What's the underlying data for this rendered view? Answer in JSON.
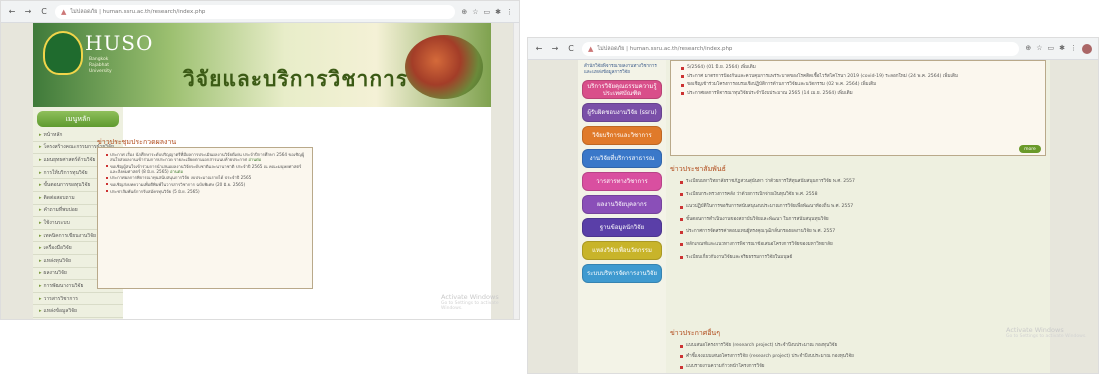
{
  "left": {
    "url": "ไม่ปลอดภัย | human.ssru.ac.th/research/index.php",
    "banner": {
      "logo_text": "HUSO",
      "logo_sub": "Bangkok Rajabhat University",
      "title": "วิจัยและบริการวิชาการ"
    },
    "nav_heading": "เมนูหลัก",
    "nav_items": [
      "หน้าหลัก",
      "โครงสร้างคณะกรรมการฝ่ายวิจัย",
      "แผนยุทธศาสตร์ด้านวิจัย",
      "การให้บริการทุนวิจัย",
      "ขั้นตอนการขอทุนวิจัย",
      "ติดต่อสอบถาม",
      "คำถามที่พบบ่อย",
      "ใช้งานระบบ",
      "เทคนิคการเขียนงานวิจัย",
      "เครื่องมือวิจัย",
      "แหล่งทุนวิจัย",
      "ผลงานวิจัย",
      "การพัฒนางานวิจัย",
      "วารสารวิชาการ",
      "แหล่งข้อมูลวิจัย",
      "การติดต่อหน่วยงาน"
    ],
    "section_title": "ข่าวประชุมประกวดผลงาน",
    "news": [
      "ประกาศ เรื่อง นักศึกษาระดับปริญญาตรีที่มีผลการประเมินผลงานวิจัยดีเด่น ประจำปีการศึกษา 2564 ขอเชิญผู้สนใจส่งผลงานเข้าร่วมการประกวด รายละเอียดตามเอกสารแนบท้ายประกาศ",
      "ขอเชิญผู้สนใจเข้าร่วมการนำเสนอผลงานวิจัยระดับชาติและนานาชาติ ประจำปี 2565 ณ คณะมนุษยศาสตร์และสังคมศาสตร์ (8 มิ.ย. 2565)",
      "ประกาศผลการพิจารณาทุนสนับสนุนการวิจัย งบประมาณรายได้ ประจำปี 2565",
      "ขอเชิญส่งบทความเพื่อตีพิมพ์ในวารสารวิชาการ ฉบับพิเศษ (20 มิ.ย. 2565)",
      "ประชาสัมพันธ์การรับสมัครทุนวิจัย (5 มิ.ย. 2565)"
    ],
    "more": "อ่านต่อ",
    "watermark": {
      "title": "Activate Windows",
      "sub": "Go to Settings to activate Windows."
    }
  },
  "right": {
    "url": "ไม่ปลอดภัย | human.ssru.ac.th/research/index.php",
    "nav_note": "สำนักวิจัยพิจารณาผลงานทางวิชาการ และแหล่งข้อมูลการวิจัย",
    "buttons": [
      {
        "label": "บริการวิจัยคุณธรรมความรู้ ประเทศบัณฑิต",
        "color": "#d94f8a"
      },
      {
        "label": "ผู้รับผิดชอบงานวิจัย (ssru)",
        "color": "#7a4fa8"
      },
      {
        "label": "วิจัยบริการและวิชาการ",
        "color": "#e07a2a"
      },
      {
        "label": "งานวิจัยที่บริการสาธารณ",
        "color": "#3a78c9"
      },
      {
        "label": "วารสารทางวิชาการ",
        "color": "#d94fa0"
      },
      {
        "label": "ผลงานวิจัยบุคลากร",
        "color": "#8a4fb8"
      },
      {
        "label": "ฐานข้อมูลนักวิจัย",
        "color": "#5a3fa8"
      },
      {
        "label": "แหล่งวิจัยเพื่อนวัตกรรม",
        "color": "#c8b42a"
      },
      {
        "label": "ระบบบริหารจัดการงานวิจัย",
        "color": "#3f9ad0"
      }
    ],
    "top_items": [
      "5/2564) (01 มิ.ย. 2564)",
      "ประกาศ มาตรการป้องกันและควบคุมการแพร่ระบาดของโรคติดเชื้อไวรัสโคโรนา 2019 (covid-19) ระลอกใหม่ (24 พ.ค. 2564)",
      "ขอเชิญเข้าร่วมโครงการอบรมเชิงปฏิบัติการด้านการวิจัยและนวัตกรรม (02 พ.ค. 2564)",
      "ประกาศผลการพิจารณาทุนวิจัยประจำปีงบประมาณ 2565 (14 เม.ย. 2564)"
    ],
    "more_link": "เพิ่มเติม",
    "more_btn": "more",
    "section1": "ข่าวประชาสัมพันธ์",
    "list1": [
      "ระเบียบมหาวิทยาลัยราชภัฏสวนสุนันทา ว่าด้วยการให้ทุนสนับสนุนการวิจัย พ.ศ. 2557",
      "ระเบียบกระทรวงการคลัง ว่าด้วยการเบิกจ่ายเงินทุนวิจัย พ.ศ. 2558",
      "แนวปฏิบัติในการขอรับการสนับสนุนงบประมาณการวิจัยเพื่อพัฒนาท้องถิ่น พ.ศ. 2557",
      "ขั้นตอนการดำเนินงานของสถาบันวิจัยและพัฒนา ในการสนับสนุนทุนวิจัย",
      "ประกาศการจัดสรรค่าตอบแทนผู้ทรงคุณวุฒิกลั่นกรองผลงานวิจัย พ.ศ. 2557",
      "หลักเกณฑ์และแนวทางการพิจารณาข้อเสนอโครงการวิจัยของมหาวิทยาลัย",
      "ระเบียบเกี่ยวกับงานวิจัยและจริยธรรมการวิจัยในมนุษย์"
    ],
    "section2": "ข่าวประกาศอื่นๆ",
    "list2": [
      "แบบเสนอโครงการวิจัย (research project) ประจำปีงบประมาณ กองทุนวิจัย",
      "คำชี้แจงแบบเสนอโครงการวิจัย (research project) ประจำปีงบประมาณ กองทุนวิจัย",
      "แบบรายงานความก้าวหน้าโครงการวิจัย"
    ],
    "watermark": {
      "title": "Activate Windows",
      "sub": "Go to Settings to activate Windows."
    }
  }
}
